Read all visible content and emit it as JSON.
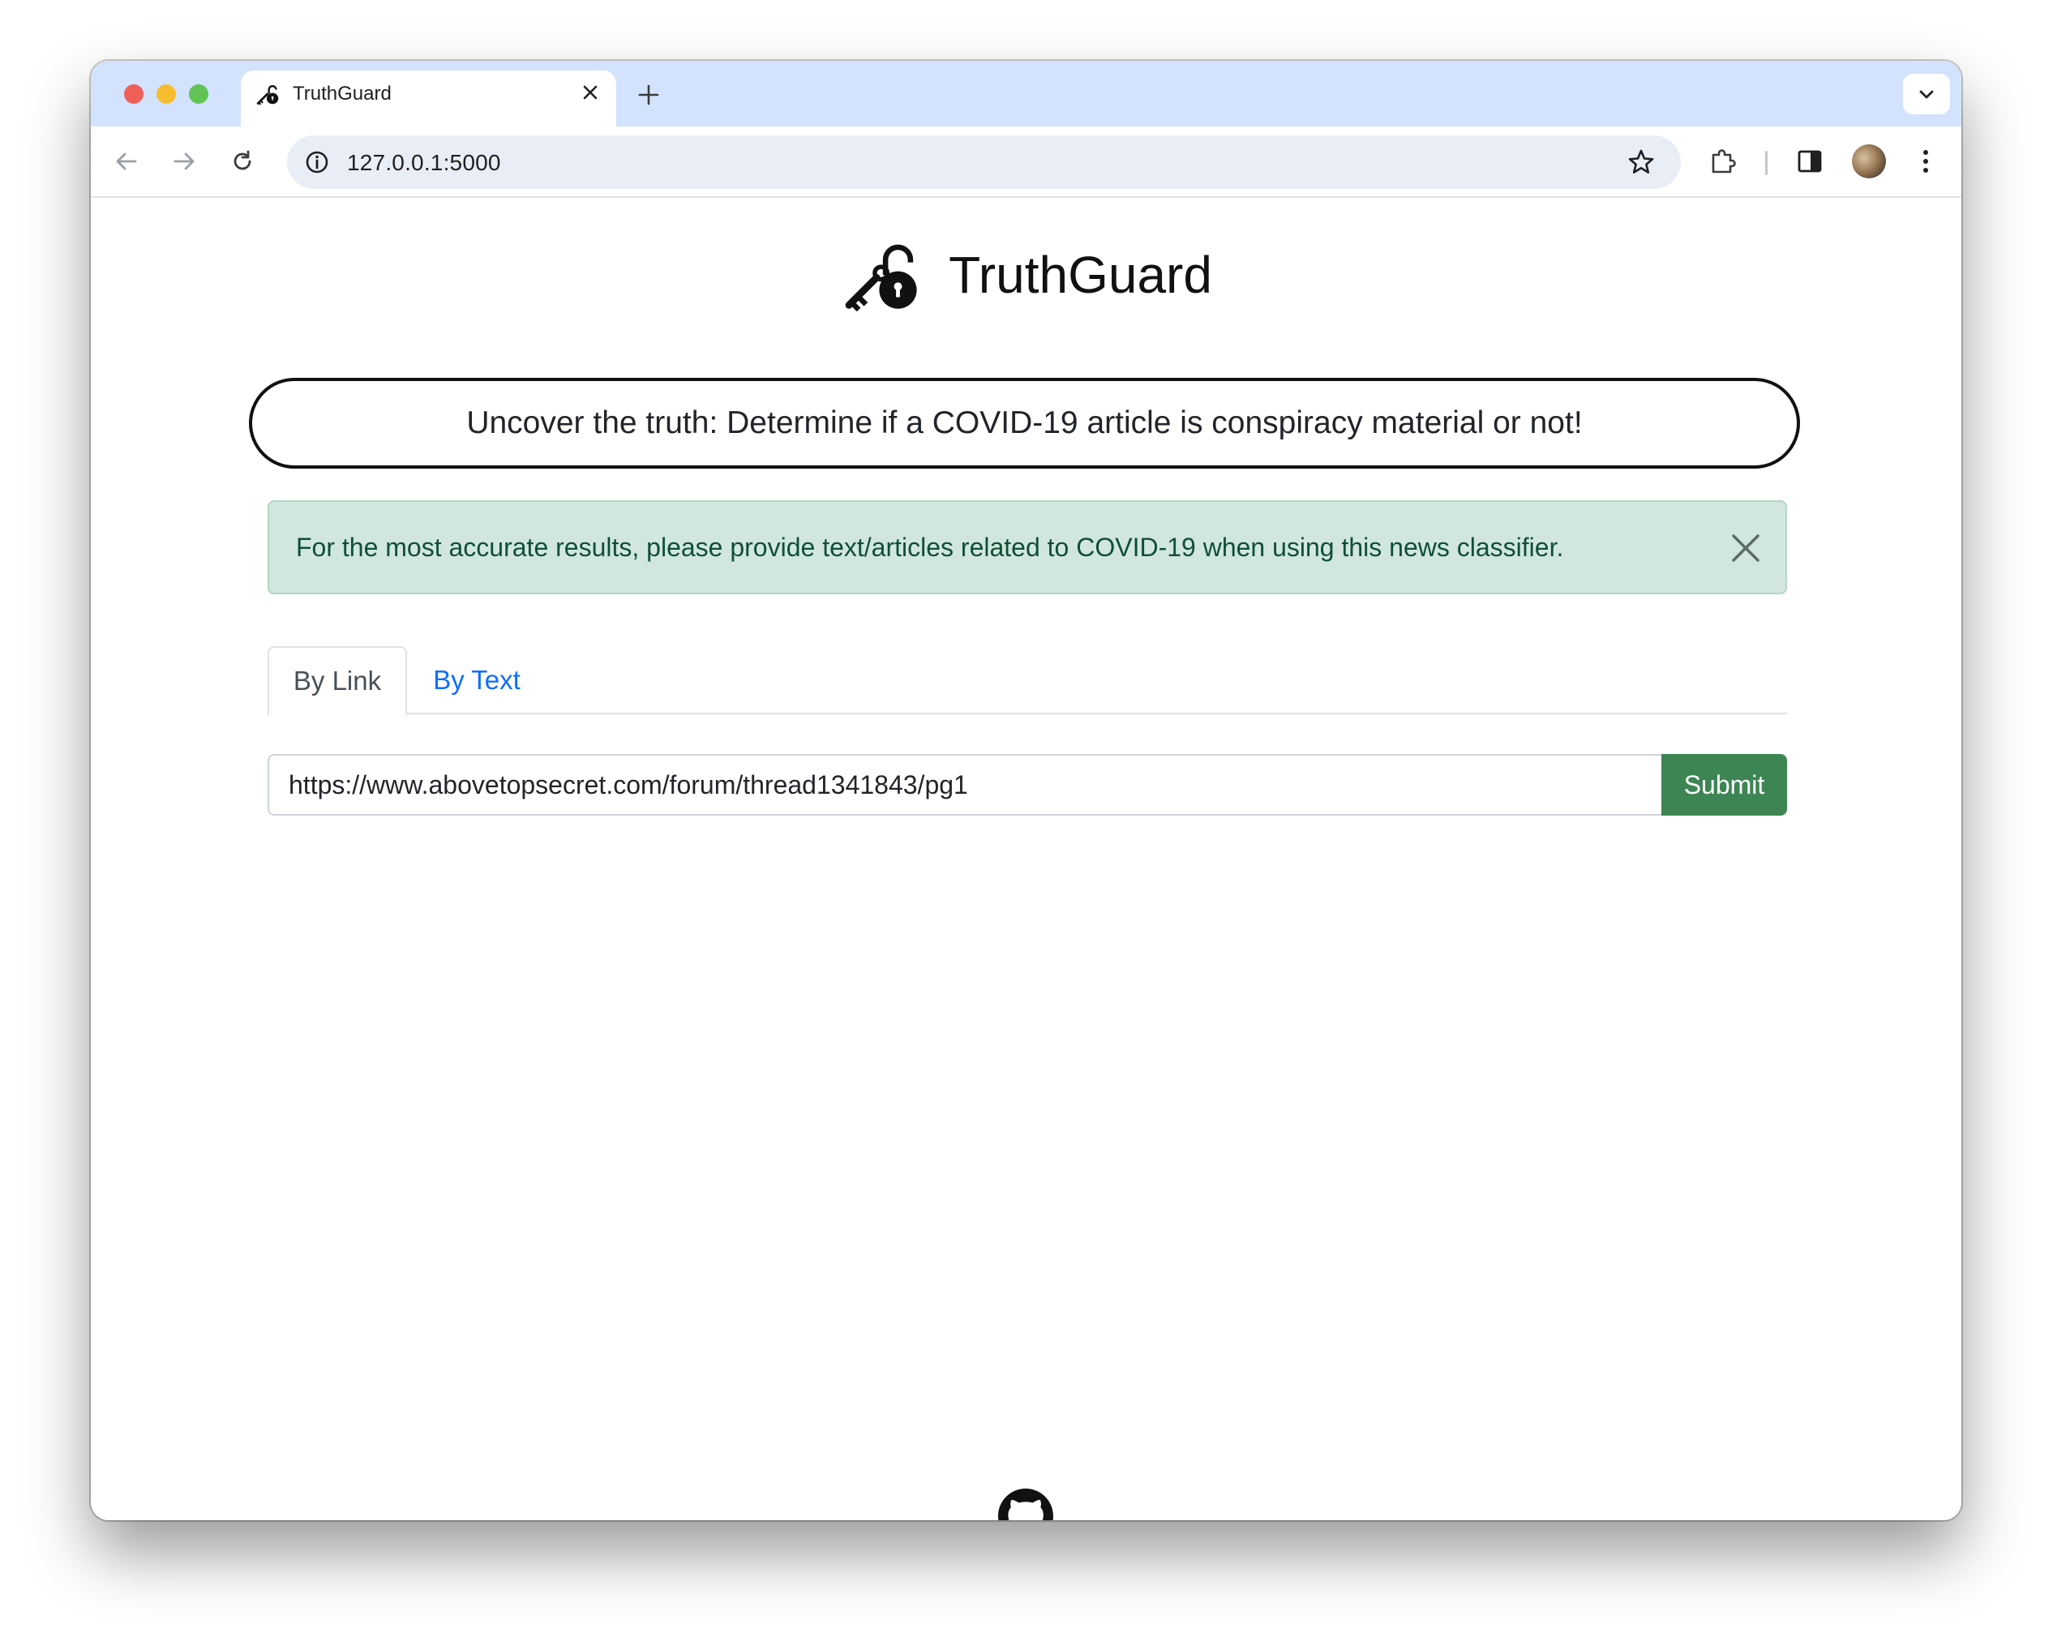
{
  "browser": {
    "tab_title": "TruthGuard",
    "url": "127.0.0.1:5000"
  },
  "page": {
    "brand_name": "TruthGuard",
    "headline": "Uncover the truth: Determine if a COVID-19 article is conspiracy material or not!",
    "alert_text": "For the most accurate results, please provide text/articles related to COVID-19 when using this news classifier.",
    "tabs": [
      {
        "label": "By Link",
        "active": true
      },
      {
        "label": "By Text",
        "active": false
      }
    ],
    "url_input_value": "https://www.abovetopsecret.com/forum/thread1341843/pg1",
    "submit_label": "Submit"
  },
  "icons": {
    "brand": "key-lock-icon",
    "footer": "github-icon"
  },
  "colors": {
    "submit": "#3d8654",
    "alert_bg": "#d1e7dd",
    "tab_strip": "#d3e3fd",
    "link": "#0d6efd"
  }
}
